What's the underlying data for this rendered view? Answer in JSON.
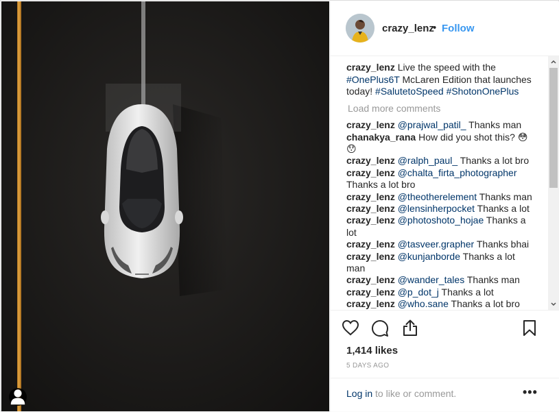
{
  "post": {
    "username": "crazy_lenz",
    "separator": "•",
    "follow_label": "Follow"
  },
  "caption": {
    "username": "crazy_lenz",
    "text_pre": " Live the speed with the ",
    "tag1": "#OnePlus6T",
    "text_mid": " McLaren Edition that launches today! ",
    "tag2": "#SalutetoSpeed",
    "tag3": "#ShotonOnePlus"
  },
  "load_more": "Load more comments",
  "comments": [
    {
      "user": "crazy_lenz",
      "mention": "@prajwal_patil_",
      "text": " Thanks man"
    },
    {
      "user": "chanakya_rana",
      "mention": "",
      "text": " How did you shot this? 😳😯"
    },
    {
      "user": "crazy_lenz",
      "mention": "@ralph_paul_",
      "text": " Thanks a lot bro"
    },
    {
      "user": "crazy_lenz",
      "mention": "@chalta_firta_photographer",
      "text": " Thanks a lot bro"
    },
    {
      "user": "crazy_lenz",
      "mention": "@theotherelement",
      "text": " Thanks man"
    },
    {
      "user": "crazy_lenz",
      "mention": "@lensinherpocket",
      "text": " Thanks a lot"
    },
    {
      "user": "crazy_lenz",
      "mention": "@photoshoto_hojae",
      "text": " Thanks a lot"
    },
    {
      "user": "crazy_lenz",
      "mention": "@tasveer.grapher",
      "text": " Thanks bhai"
    },
    {
      "user": "crazy_lenz",
      "mention": "@kunjanborde",
      "text": " Thanks a lot man"
    },
    {
      "user": "crazy_lenz",
      "mention": "@wander_tales",
      "text": " Thanks man"
    },
    {
      "user": "crazy_lenz",
      "mention": "@p_dot_j",
      "text": " Thanks a lot"
    },
    {
      "user": "crazy_lenz",
      "mention": "@who.sane",
      "text": " Thanks a lot bro"
    }
  ],
  "likes": "1,414 likes",
  "date": "5 DAYS AGO",
  "login": {
    "link": "Log in",
    "rest": " to like or comment."
  },
  "more_label": "•••",
  "colors": {
    "link_blue": "#003569",
    "follow_blue": "#3897f0",
    "muted": "#999999",
    "road": "#1b1a19",
    "lane_yellow": "#c98a2a"
  },
  "icons": [
    "heart-icon",
    "comment-icon",
    "share-icon",
    "bookmark-icon",
    "user-tag-icon",
    "more-icon"
  ]
}
